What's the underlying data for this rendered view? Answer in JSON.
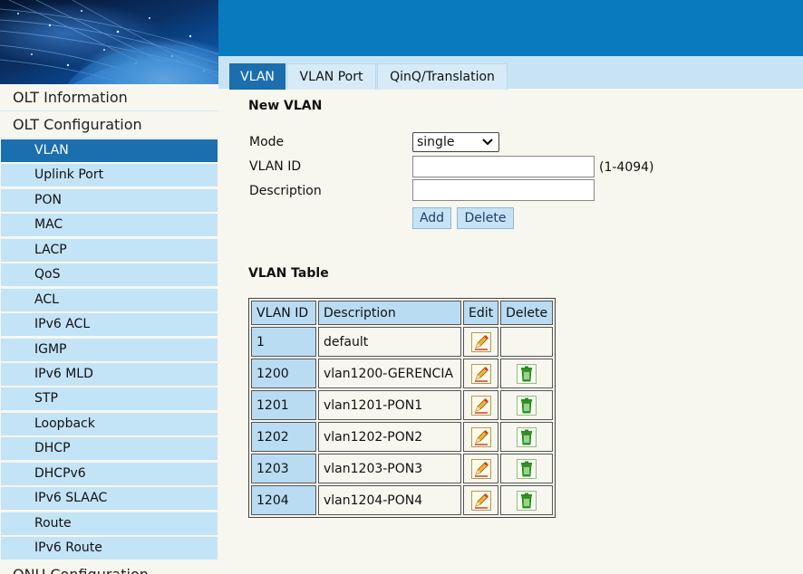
{
  "header": {},
  "tabs": [
    {
      "label": "VLAN",
      "active": true
    },
    {
      "label": "VLAN Port",
      "active": false
    },
    {
      "label": "QinQ/Translation",
      "active": false
    }
  ],
  "sidebar": {
    "sections": [
      "OLT Information",
      "OLT Configuration",
      "ONU Configuration"
    ],
    "items": [
      {
        "label": "VLAN",
        "active": true
      },
      {
        "label": "Uplink Port"
      },
      {
        "label": "PON"
      },
      {
        "label": "MAC"
      },
      {
        "label": "LACP"
      },
      {
        "label": "QoS"
      },
      {
        "label": "ACL"
      },
      {
        "label": "IPv6 ACL"
      },
      {
        "label": "IGMP"
      },
      {
        "label": "IPv6 MLD"
      },
      {
        "label": "STP"
      },
      {
        "label": "Loopback"
      },
      {
        "label": "DHCP"
      },
      {
        "label": "DHCPv6"
      },
      {
        "label": "IPv6 SLAAC"
      },
      {
        "label": "Route"
      },
      {
        "label": "IPv6 Route"
      }
    ]
  },
  "new_vlan": {
    "title": "New VLAN",
    "mode_label": "Mode",
    "mode_value": "single",
    "vlan_id_label": "VLAN ID",
    "vlan_id_value": "",
    "vlan_id_hint": "(1-4094)",
    "description_label": "Description",
    "description_value": "",
    "add_label": "Add",
    "delete_label": "Delete"
  },
  "vlan_table": {
    "title": "VLAN Table",
    "columns": [
      "VLAN ID",
      "Description",
      "Edit",
      "Delete"
    ],
    "rows": [
      {
        "id": "1",
        "description": "default",
        "deletable": false
      },
      {
        "id": "1200",
        "description": "vlan1200-GERENCIA",
        "deletable": true
      },
      {
        "id": "1201",
        "description": "vlan1201-PON1",
        "deletable": true
      },
      {
        "id": "1202",
        "description": "vlan1202-PON2",
        "deletable": true
      },
      {
        "id": "1203",
        "description": "vlan1203-PON3",
        "deletable": true
      },
      {
        "id": "1204",
        "description": "vlan1204-PON4",
        "deletable": true
      }
    ]
  },
  "colors": {
    "header_blue": "#0a7abf",
    "active_blue": "#1b6fae",
    "light_blue": "#c3e3f7",
    "background": "#f7f7ef"
  },
  "icons": {
    "edit": "pencil-icon",
    "delete": "trash-icon"
  }
}
